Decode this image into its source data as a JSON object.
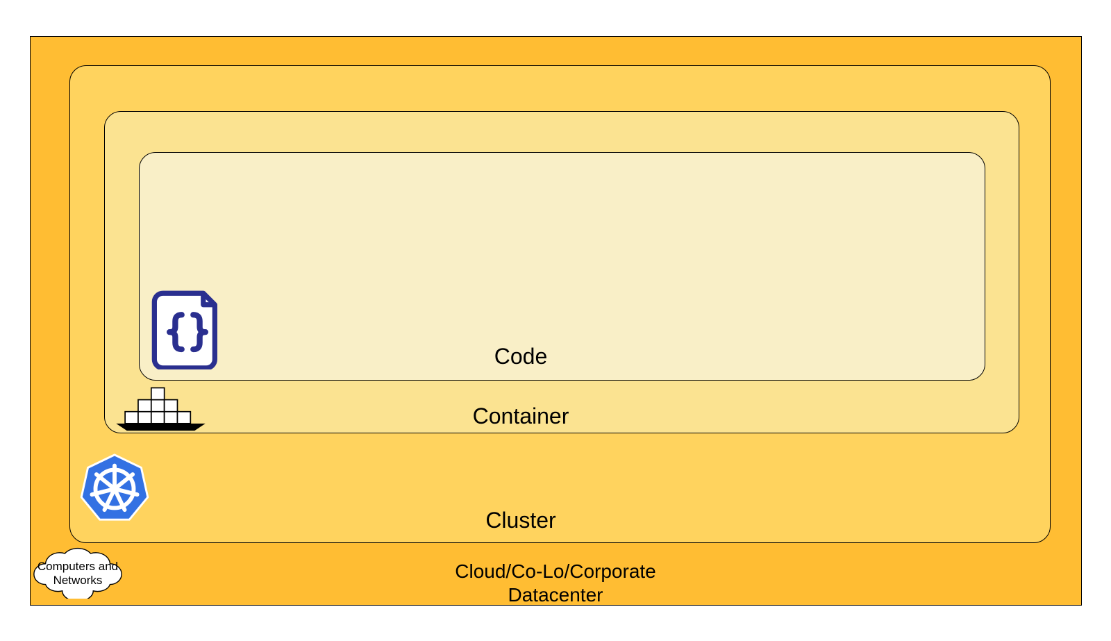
{
  "layers": {
    "datacenter": {
      "label": "Cloud/Co-Lo/Corporate\nDatacenter",
      "color": "#ffbd33"
    },
    "cluster": {
      "label": "Cluster",
      "color": "#ffd35e"
    },
    "container": {
      "label": "Container",
      "color": "#fbe391"
    },
    "code": {
      "label": "Code",
      "color": "#f9efc7"
    }
  },
  "icons": {
    "cloud_label": "Computers and\nNetworks",
    "kubernetes": "kubernetes-icon",
    "docker": "container-ship-icon",
    "code_file": "code-file-icon"
  }
}
